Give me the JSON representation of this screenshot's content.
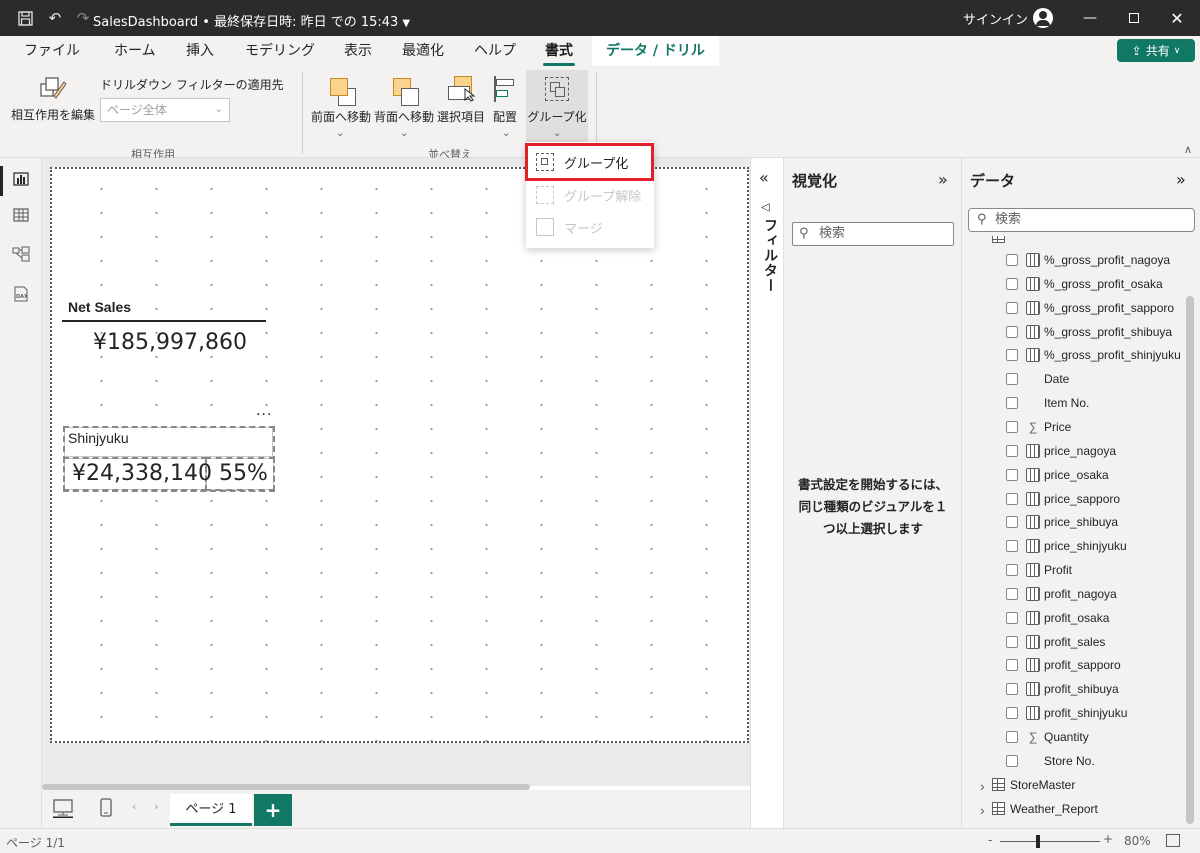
{
  "window": {
    "title": "SalesDashboard • 最終保存日時: 昨日 での 15:43",
    "signin": "サインイン"
  },
  "tabs": [
    "ファイル",
    "ホーム",
    "挿入",
    "モデリング",
    "表示",
    "最適化",
    "ヘルプ",
    "書式",
    "データ / ドリル"
  ],
  "active_tab": "書式",
  "share_label": "共有",
  "ribbon": {
    "interaction": {
      "edit_label": "相互作用を編集",
      "drill_label": "ドリルダウン フィルターの適用先",
      "drill_select": "ページ全体",
      "group_label": "相互作用"
    },
    "arrange": {
      "forward": "前面へ移動",
      "backward": "背面へ移動",
      "selection": "選択項目",
      "align": "配置",
      "group": "グループ化",
      "group_label": "並べ替え"
    }
  },
  "dropdown": {
    "items": [
      {
        "label": "グループ化",
        "enabled": true
      },
      {
        "label": "グループ解除",
        "enabled": false
      },
      {
        "label": "マージ",
        "enabled": false
      }
    ]
  },
  "canvas": {
    "card1": {
      "title": "Net Sales",
      "value": "¥185,997,860"
    },
    "card2": {
      "title": "Shinjyuku",
      "value": "¥24,338,140",
      "percent": "55%"
    },
    "more": "..."
  },
  "pages": {
    "tab": "ページ 1",
    "add": "+"
  },
  "filter_label": "フィルター",
  "visualization": {
    "title": "視覚化",
    "search": "検索",
    "note": "書式設定を開始するには、同じ種類のビジュアルを１つ以上選択します"
  },
  "data": {
    "title": "データ",
    "search": "検索",
    "fields": [
      {
        "name": "%_gross_profit_nagoya",
        "icon": "calc"
      },
      {
        "name": "%_gross_profit_osaka",
        "icon": "calc"
      },
      {
        "name": "%_gross_profit_sapporo",
        "icon": "calc"
      },
      {
        "name": "%_gross_profit_shibuya",
        "icon": "calc"
      },
      {
        "name": "%_gross_profit_shinjyuku",
        "icon": "calc"
      },
      {
        "name": "Date",
        "icon": "none"
      },
      {
        "name": "Item No.",
        "icon": "none"
      },
      {
        "name": "Price",
        "icon": "sigma"
      },
      {
        "name": "price_nagoya",
        "icon": "calc"
      },
      {
        "name": "price_osaka",
        "icon": "calc"
      },
      {
        "name": "price_sapporo",
        "icon": "calc"
      },
      {
        "name": "price_shibuya",
        "icon": "calc"
      },
      {
        "name": "price_shinjyuku",
        "icon": "calc"
      },
      {
        "name": "Profit",
        "icon": "calc-table"
      },
      {
        "name": "profit_nagoya",
        "icon": "calc"
      },
      {
        "name": "profit_osaka",
        "icon": "calc"
      },
      {
        "name": "profit_sales",
        "icon": "calc"
      },
      {
        "name": "profit_sapporo",
        "icon": "calc"
      },
      {
        "name": "profit_shibuya",
        "icon": "calc"
      },
      {
        "name": "profit_shinjyuku",
        "icon": "calc"
      },
      {
        "name": "Quantity",
        "icon": "sigma"
      },
      {
        "name": "Store No.",
        "icon": "none"
      }
    ],
    "tables": [
      "StoreMaster",
      "Weather_Report"
    ]
  },
  "status": {
    "page": "ページ 1/1",
    "zoom": "80%",
    "minus": "-",
    "plus": "+"
  },
  "colors": {
    "accent": "#117865",
    "highlight": "#e3202a",
    "titlebar": "#2b2b2b"
  }
}
